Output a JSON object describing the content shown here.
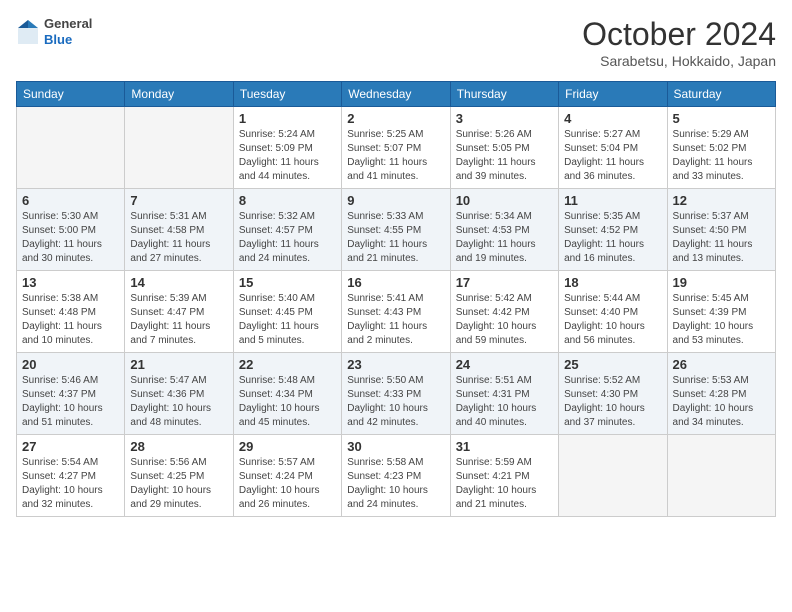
{
  "header": {
    "logo": {
      "general": "General",
      "blue": "Blue"
    },
    "title": "October 2024",
    "location": "Sarabetsu, Hokkaido, Japan"
  },
  "days_of_week": [
    "Sunday",
    "Monday",
    "Tuesday",
    "Wednesday",
    "Thursday",
    "Friday",
    "Saturday"
  ],
  "weeks": [
    [
      {
        "day": "",
        "empty": true
      },
      {
        "day": "",
        "empty": true
      },
      {
        "day": "1",
        "sunrise": "Sunrise: 5:24 AM",
        "sunset": "Sunset: 5:09 PM",
        "daylight": "Daylight: 11 hours and 44 minutes."
      },
      {
        "day": "2",
        "sunrise": "Sunrise: 5:25 AM",
        "sunset": "Sunset: 5:07 PM",
        "daylight": "Daylight: 11 hours and 41 minutes."
      },
      {
        "day": "3",
        "sunrise": "Sunrise: 5:26 AM",
        "sunset": "Sunset: 5:05 PM",
        "daylight": "Daylight: 11 hours and 39 minutes."
      },
      {
        "day": "4",
        "sunrise": "Sunrise: 5:27 AM",
        "sunset": "Sunset: 5:04 PM",
        "daylight": "Daylight: 11 hours and 36 minutes."
      },
      {
        "day": "5",
        "sunrise": "Sunrise: 5:29 AM",
        "sunset": "Sunset: 5:02 PM",
        "daylight": "Daylight: 11 hours and 33 minutes."
      }
    ],
    [
      {
        "day": "6",
        "sunrise": "Sunrise: 5:30 AM",
        "sunset": "Sunset: 5:00 PM",
        "daylight": "Daylight: 11 hours and 30 minutes."
      },
      {
        "day": "7",
        "sunrise": "Sunrise: 5:31 AM",
        "sunset": "Sunset: 4:58 PM",
        "daylight": "Daylight: 11 hours and 27 minutes."
      },
      {
        "day": "8",
        "sunrise": "Sunrise: 5:32 AM",
        "sunset": "Sunset: 4:57 PM",
        "daylight": "Daylight: 11 hours and 24 minutes."
      },
      {
        "day": "9",
        "sunrise": "Sunrise: 5:33 AM",
        "sunset": "Sunset: 4:55 PM",
        "daylight": "Daylight: 11 hours and 21 minutes."
      },
      {
        "day": "10",
        "sunrise": "Sunrise: 5:34 AM",
        "sunset": "Sunset: 4:53 PM",
        "daylight": "Daylight: 11 hours and 19 minutes."
      },
      {
        "day": "11",
        "sunrise": "Sunrise: 5:35 AM",
        "sunset": "Sunset: 4:52 PM",
        "daylight": "Daylight: 11 hours and 16 minutes."
      },
      {
        "day": "12",
        "sunrise": "Sunrise: 5:37 AM",
        "sunset": "Sunset: 4:50 PM",
        "daylight": "Daylight: 11 hours and 13 minutes."
      }
    ],
    [
      {
        "day": "13",
        "sunrise": "Sunrise: 5:38 AM",
        "sunset": "Sunset: 4:48 PM",
        "daylight": "Daylight: 11 hours and 10 minutes."
      },
      {
        "day": "14",
        "sunrise": "Sunrise: 5:39 AM",
        "sunset": "Sunset: 4:47 PM",
        "daylight": "Daylight: 11 hours and 7 minutes."
      },
      {
        "day": "15",
        "sunrise": "Sunrise: 5:40 AM",
        "sunset": "Sunset: 4:45 PM",
        "daylight": "Daylight: 11 hours and 5 minutes."
      },
      {
        "day": "16",
        "sunrise": "Sunrise: 5:41 AM",
        "sunset": "Sunset: 4:43 PM",
        "daylight": "Daylight: 11 hours and 2 minutes."
      },
      {
        "day": "17",
        "sunrise": "Sunrise: 5:42 AM",
        "sunset": "Sunset: 4:42 PM",
        "daylight": "Daylight: 10 hours and 59 minutes."
      },
      {
        "day": "18",
        "sunrise": "Sunrise: 5:44 AM",
        "sunset": "Sunset: 4:40 PM",
        "daylight": "Daylight: 10 hours and 56 minutes."
      },
      {
        "day": "19",
        "sunrise": "Sunrise: 5:45 AM",
        "sunset": "Sunset: 4:39 PM",
        "daylight": "Daylight: 10 hours and 53 minutes."
      }
    ],
    [
      {
        "day": "20",
        "sunrise": "Sunrise: 5:46 AM",
        "sunset": "Sunset: 4:37 PM",
        "daylight": "Daylight: 10 hours and 51 minutes."
      },
      {
        "day": "21",
        "sunrise": "Sunrise: 5:47 AM",
        "sunset": "Sunset: 4:36 PM",
        "daylight": "Daylight: 10 hours and 48 minutes."
      },
      {
        "day": "22",
        "sunrise": "Sunrise: 5:48 AM",
        "sunset": "Sunset: 4:34 PM",
        "daylight": "Daylight: 10 hours and 45 minutes."
      },
      {
        "day": "23",
        "sunrise": "Sunrise: 5:50 AM",
        "sunset": "Sunset: 4:33 PM",
        "daylight": "Daylight: 10 hours and 42 minutes."
      },
      {
        "day": "24",
        "sunrise": "Sunrise: 5:51 AM",
        "sunset": "Sunset: 4:31 PM",
        "daylight": "Daylight: 10 hours and 40 minutes."
      },
      {
        "day": "25",
        "sunrise": "Sunrise: 5:52 AM",
        "sunset": "Sunset: 4:30 PM",
        "daylight": "Daylight: 10 hours and 37 minutes."
      },
      {
        "day": "26",
        "sunrise": "Sunrise: 5:53 AM",
        "sunset": "Sunset: 4:28 PM",
        "daylight": "Daylight: 10 hours and 34 minutes."
      }
    ],
    [
      {
        "day": "27",
        "sunrise": "Sunrise: 5:54 AM",
        "sunset": "Sunset: 4:27 PM",
        "daylight": "Daylight: 10 hours and 32 minutes."
      },
      {
        "day": "28",
        "sunrise": "Sunrise: 5:56 AM",
        "sunset": "Sunset: 4:25 PM",
        "daylight": "Daylight: 10 hours and 29 minutes."
      },
      {
        "day": "29",
        "sunrise": "Sunrise: 5:57 AM",
        "sunset": "Sunset: 4:24 PM",
        "daylight": "Daylight: 10 hours and 26 minutes."
      },
      {
        "day": "30",
        "sunrise": "Sunrise: 5:58 AM",
        "sunset": "Sunset: 4:23 PM",
        "daylight": "Daylight: 10 hours and 24 minutes."
      },
      {
        "day": "31",
        "sunrise": "Sunrise: 5:59 AM",
        "sunset": "Sunset: 4:21 PM",
        "daylight": "Daylight: 10 hours and 21 minutes."
      },
      {
        "day": "",
        "empty": true
      },
      {
        "day": "",
        "empty": true
      }
    ]
  ]
}
